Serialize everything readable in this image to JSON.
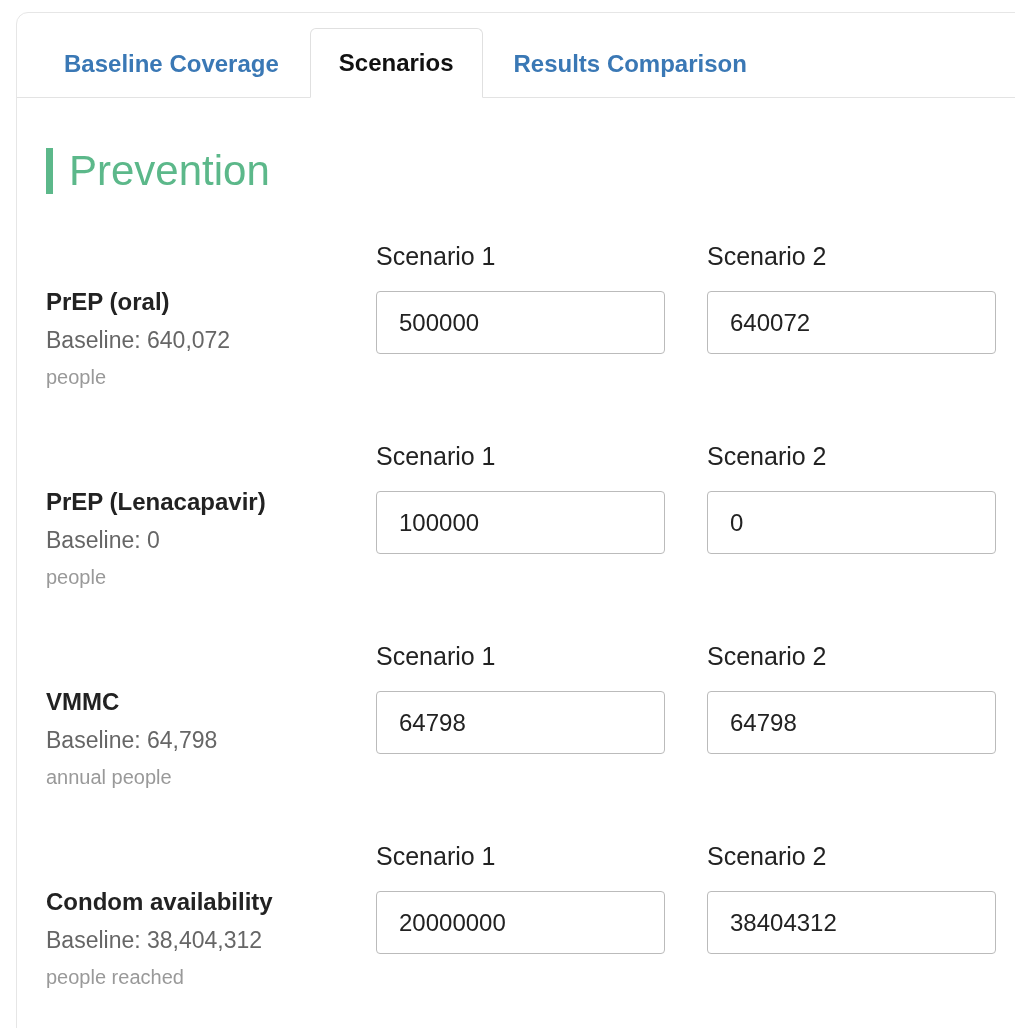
{
  "tabs": [
    {
      "label": "Baseline Coverage",
      "selected": false
    },
    {
      "label": "Scenarios",
      "selected": true
    },
    {
      "label": "Results Comparison",
      "selected": false
    }
  ],
  "section": {
    "title": "Prevention"
  },
  "rows": [
    {
      "name": "PrEP (oral)",
      "baseline": "Baseline: 640,072",
      "unit": "people",
      "scenarios": [
        {
          "label": "Scenario 1",
          "value": "500000"
        },
        {
          "label": "Scenario 2",
          "value": "640072"
        }
      ]
    },
    {
      "name": "PrEP (Lenacapavir)",
      "baseline": "Baseline: 0",
      "unit": "people",
      "scenarios": [
        {
          "label": "Scenario 1",
          "value": "100000"
        },
        {
          "label": "Scenario 2",
          "value": "0"
        }
      ]
    },
    {
      "name": "VMMC",
      "baseline": "Baseline: 64,798",
      "unit": "annual people",
      "scenarios": [
        {
          "label": "Scenario 1",
          "value": "64798"
        },
        {
          "label": "Scenario 2",
          "value": "64798"
        }
      ]
    },
    {
      "name": "Condom availability",
      "baseline": "Baseline: 38,404,312",
      "unit": "people reached",
      "scenarios": [
        {
          "label": "Scenario 1",
          "value": "20000000"
        },
        {
          "label": "Scenario 2",
          "value": "38404312"
        }
      ]
    }
  ]
}
